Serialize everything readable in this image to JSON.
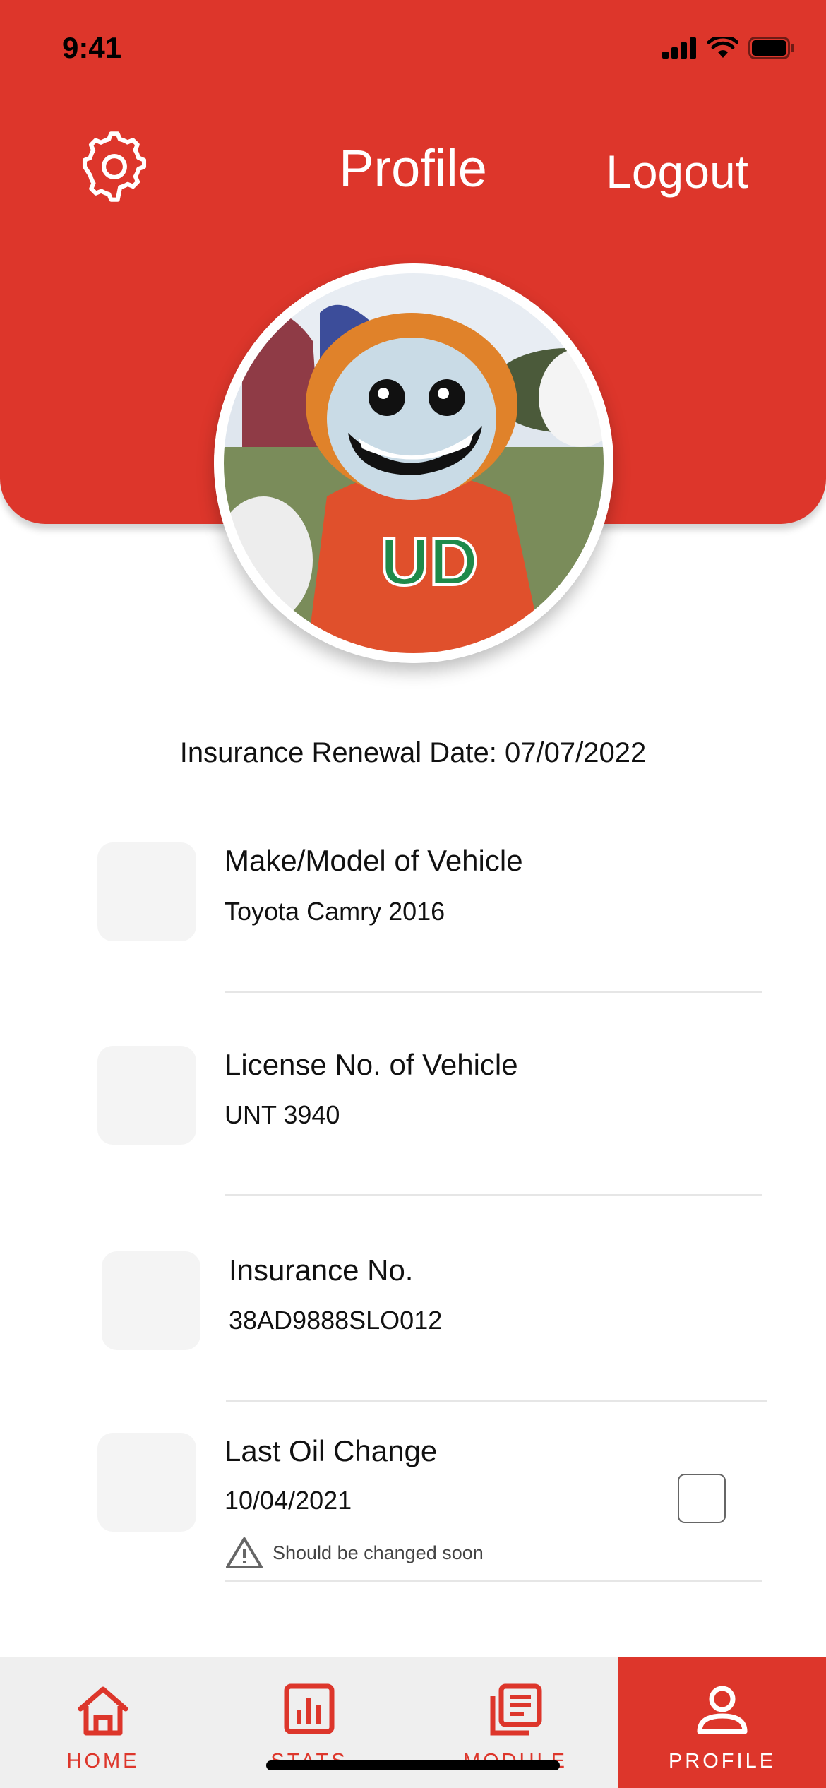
{
  "status_bar": {
    "time": "9:41"
  },
  "header": {
    "title": "Profile",
    "logout_label": "Logout",
    "settings_icon": "gear-icon"
  },
  "colors": {
    "brand": "#DD362B",
    "nav_bg": "#EFEFEF",
    "thumb_bg": "#F4F4F4"
  },
  "renewal_text": "Insurance Renewal Date: 07/07/2022",
  "items": [
    {
      "label": "Make/Model of Vehicle",
      "value": "Toyota Camry 2016"
    },
    {
      "label": "License No. of Vehicle",
      "value": "UNT 3940"
    },
    {
      "label": "Insurance No.",
      "value": "38AD9888SLO012"
    },
    {
      "label": "Last Oil Change",
      "value": "10/04/2021",
      "warning": "Should be changed soon",
      "checked": false
    }
  ],
  "avatar": {
    "shirt_text": "UD"
  },
  "nav": [
    {
      "label": "HOME",
      "icon": "home-icon"
    },
    {
      "label": "STATS",
      "icon": "stats-icon"
    },
    {
      "label": "MODULE",
      "icon": "module-icon"
    },
    {
      "label": "PROFILE",
      "icon": "profile-icon",
      "active": true
    }
  ]
}
